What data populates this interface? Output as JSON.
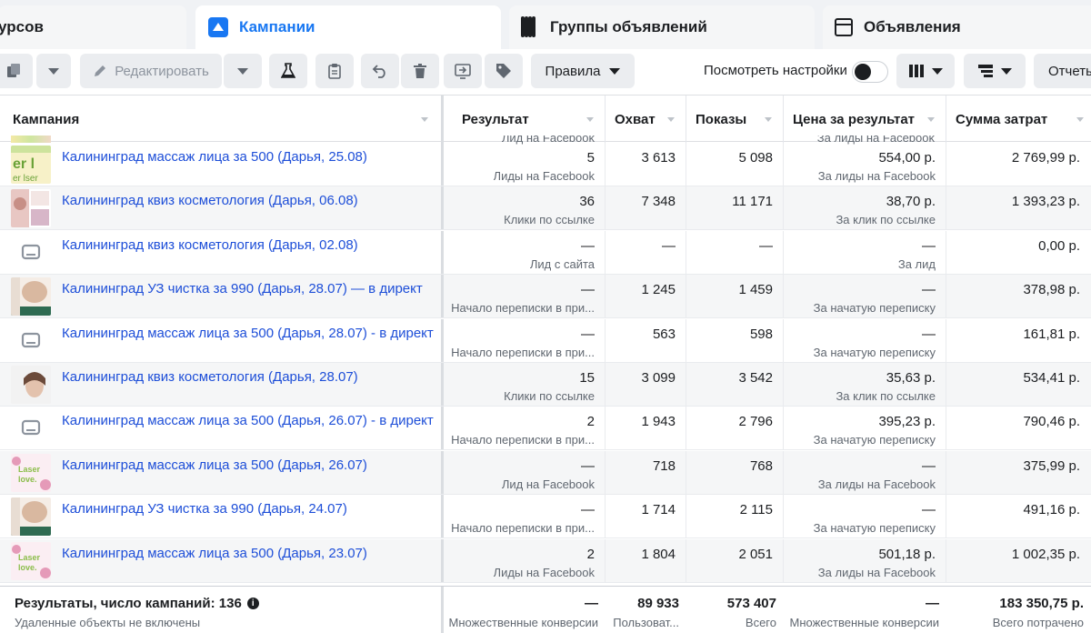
{
  "tabs": [
    {
      "label": "урсов",
      "active": false
    },
    {
      "label": "Кампании",
      "active": true
    },
    {
      "label": "Группы объявлений",
      "active": false
    },
    {
      "label": "Объявления",
      "active": false
    }
  ],
  "toolbar": {
    "edit_label": "Редактировать",
    "rules_label": "Правила",
    "view_settings_label": "Посмотреть настройки",
    "reports_label": "Отчеты"
  },
  "columns": {
    "campaign": "Кампания",
    "result": "Результат",
    "reach": "Охват",
    "impressions": "Показы",
    "cost_per_result": "Цена за результат",
    "amount_spent": "Сумма затрат"
  },
  "ghost_row": {
    "result_sub": "Лид на Facebook",
    "cost_sub": "За лиды на Facebook"
  },
  "rows": [
    {
      "name": "Калининград массаж лица за 500 (Дарья, 25.08)",
      "thumb": "thumb-laser-green",
      "result": "5",
      "result_sub": "Лиды на Facebook",
      "reach": "3 613",
      "impressions": "5 098",
      "cost": "554,00 р.",
      "cost_sub": "За лиды на Facebook",
      "spent": "2 769,99 р."
    },
    {
      "name": "Калининград квиз косметология (Дарья, 06.08)",
      "thumb": "thumb-cosmetology",
      "result": "36",
      "result_sub": "Клики по ссылке",
      "reach": "7 348",
      "impressions": "11 171",
      "cost": "38,70 р.",
      "cost_sub": "За клик по ссылке",
      "spent": "1 393,23 р."
    },
    {
      "name": "Калининград квиз косметология (Дарья, 02.08)",
      "thumb": "placeholder",
      "result": "—",
      "result_sub": "Лид с сайта",
      "reach": "—",
      "impressions": "—",
      "cost": "—",
      "cost_sub": "За лид",
      "spent": "0,00 р."
    },
    {
      "name": "Калининград УЗ чистка за 990 (Дарья, 28.07) — в директ",
      "thumb": "thumb-face-care",
      "result": "—",
      "result_sub": "Начало переписки в при...",
      "reach": "1 245",
      "impressions": "1 459",
      "cost": "—",
      "cost_sub": "За начатую переписку",
      "spent": "378,98 р."
    },
    {
      "name": "Калининград массаж лица за 500 (Дарья, 28.07) - в директ",
      "thumb": "placeholder",
      "result": "—",
      "result_sub": "Начало переписки в при...",
      "reach": "563",
      "impressions": "598",
      "cost": "—",
      "cost_sub": "За начатую переписку",
      "spent": "161,81 р."
    },
    {
      "name": "Калининград квиз косметология (Дарья, 28.07)",
      "thumb": "thumb-portrait",
      "result": "15",
      "result_sub": "Клики по ссылке",
      "reach": "3 099",
      "impressions": "3 542",
      "cost": "35,63 р.",
      "cost_sub": "За клик по ссылке",
      "spent": "534,41 р."
    },
    {
      "name": "Калининград массаж лица за 500 (Дарья, 26.07) - в директ",
      "thumb": "placeholder",
      "result": "2",
      "result_sub": "Начало переписки в при...",
      "reach": "1 943",
      "impressions": "2 796",
      "cost": "395,23 р.",
      "cost_sub": "За начатую переписку",
      "spent": "790,46 р."
    },
    {
      "name": "Калининград массаж лица за 500 (Дарья, 26.07)",
      "thumb": "thumb-laser-pink",
      "result": "—",
      "result_sub": "Лид на Facebook",
      "reach": "718",
      "impressions": "768",
      "cost": "—",
      "cost_sub": "За лиды на Facebook",
      "spent": "375,99 р."
    },
    {
      "name": "Калининград УЗ чистка за 990 (Дарья, 24.07)",
      "thumb": "thumb-face-care",
      "result": "—",
      "result_sub": "Начало переписки в при...",
      "reach": "1 714",
      "impressions": "2 115",
      "cost": "—",
      "cost_sub": "За начатую переписку",
      "spent": "491,16 р."
    },
    {
      "name": "Калининград массаж лица за 500 (Дарья, 23.07)",
      "thumb": "thumb-laser-pink",
      "result": "2",
      "result_sub": "Лиды на Facebook",
      "reach": "1 804",
      "impressions": "2 051",
      "cost": "501,18 р.",
      "cost_sub": "За лиды на Facebook",
      "spent": "1 002,35 р."
    }
  ],
  "footer": {
    "title": "Результаты, число кампаний: 136",
    "subtitle": "Удаленные объекты не включены",
    "result": "—",
    "result_sub": "Множественные конверсии",
    "reach": "89 933",
    "reach_sub": "Пользоват...",
    "impressions": "573 407",
    "impressions_sub": "Всего",
    "cost": "—",
    "cost_sub": "Множественные конверсии",
    "spent": "183 350,75 р.",
    "spent_sub": "Всего потрачено"
  },
  "colors": {
    "accent": "#1877f2",
    "link": "#1d4ed8",
    "header_bg": "#f0f2f5",
    "alt_row": "#f5f6f7"
  }
}
